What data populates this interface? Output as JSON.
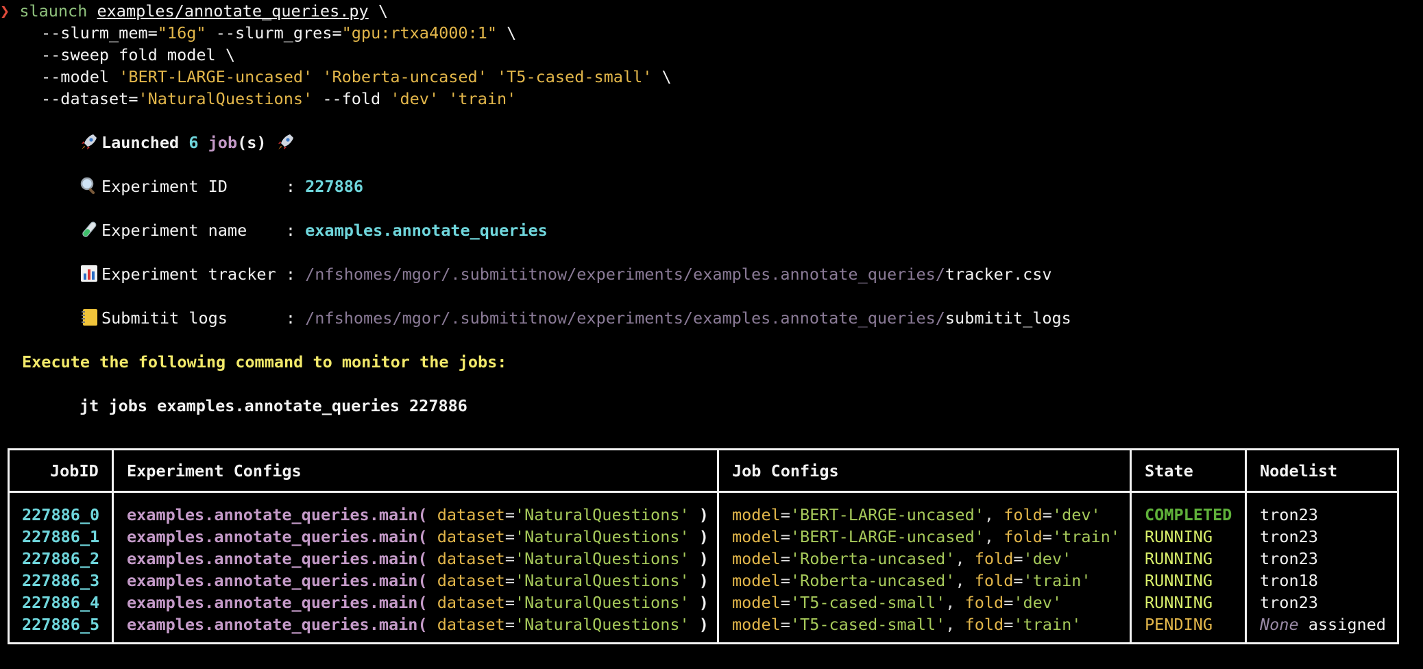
{
  "terminal": {
    "prompt_symbol": "❯",
    "command": {
      "program": "slaunch",
      "script": "examples/annotate_queries.py",
      "continuation": "\\",
      "line2": {
        "flag_mem": "--slurm_mem=",
        "mem_value": "\"16g\"",
        "flag_gres": "--slurm_gres=",
        "gres_value": "\"gpu:rtxa4000:1\""
      },
      "line3": "--sweep fold model \\",
      "line4": {
        "flag_model": "--model",
        "models": [
          "'BERT-LARGE-uncased'",
          "'Roberta-uncased'",
          "'T5-cased-small'"
        ]
      },
      "line5": {
        "flag_dataset": "--dataset=",
        "dataset_value": "'NaturalQuestions'",
        "flag_fold": "--fold",
        "folds": [
          "'dev'",
          "'train'"
        ]
      }
    },
    "launched": {
      "prefix": "Launched",
      "count": "6",
      "unit": "job",
      "suffix": "(s)"
    },
    "info": {
      "experiment_id_label": "Experiment ID      :",
      "experiment_id": "227886",
      "experiment_name_label": "Experiment name    :",
      "experiment_name": "examples.annotate_queries",
      "tracker_label": "Experiment tracker :",
      "tracker_dir": "/nfshomes/mgor/.submititnow/experiments/examples.annotate_queries/",
      "tracker_file": "tracker.csv",
      "logs_label": "Submitit logs      :",
      "logs_dir": "/nfshomes/mgor/.submititnow/experiments/examples.annotate_queries/",
      "logs_file": "submitit_logs"
    },
    "monitor_banner": "Execute the following command to monitor the jobs:",
    "monitor_command": "jt jobs examples.annotate_queries 227886"
  },
  "table": {
    "headers": [
      "JobID",
      "Experiment Configs",
      "Job Configs",
      "State",
      "Nodelist"
    ],
    "rows": [
      {
        "job_id": "227886_0",
        "fn": "examples.annotate_queries.main(",
        "kw": "dataset",
        "ds": "'NaturalQuestions'",
        "model": "'BERT-LARGE-uncased'",
        "fold": "'dev'",
        "state": "COMPLETED",
        "node": "tron23"
      },
      {
        "job_id": "227886_1",
        "fn": "examples.annotate_queries.main(",
        "kw": "dataset",
        "ds": "'NaturalQuestions'",
        "model": "'BERT-LARGE-uncased'",
        "fold": "'train'",
        "state": "RUNNING",
        "node": "tron23"
      },
      {
        "job_id": "227886_2",
        "fn": "examples.annotate_queries.main(",
        "kw": "dataset",
        "ds": "'NaturalQuestions'",
        "model": "'Roberta-uncased'",
        "fold": "'dev'",
        "state": "RUNNING",
        "node": "tron23"
      },
      {
        "job_id": "227886_3",
        "fn": "examples.annotate_queries.main(",
        "kw": "dataset",
        "ds": "'NaturalQuestions'",
        "model": "'Roberta-uncased'",
        "fold": "'train'",
        "state": "RUNNING",
        "node": "tron18"
      },
      {
        "job_id": "227886_4",
        "fn": "examples.annotate_queries.main(",
        "kw": "dataset",
        "ds": "'NaturalQuestions'",
        "model": "'T5-cased-small'",
        "fold": "'dev'",
        "state": "RUNNING",
        "node": "tron23"
      },
      {
        "job_id": "227886_5",
        "fn": "examples.annotate_queries.main(",
        "kw": "dataset",
        "ds": "'NaturalQuestions'",
        "model": "'T5-cased-small'",
        "fold": "'train'",
        "state": "PENDING",
        "node_none": "None",
        "node_suffix": "assigned"
      }
    ],
    "close_paren": ")",
    "model_key": "model",
    "fold_key": "fold",
    "separator": ","
  },
  "colors": {
    "background": "#000000",
    "prompt": "#e04a3a",
    "command": "#8ec07c",
    "string": "#e2b64a",
    "cyan": "#6fd6dc",
    "function": "#c49ac8",
    "banner": "#f2e96a",
    "completed": "#5fb13a",
    "running": "#d7ed6a",
    "pending": "#e2b64a"
  },
  "icons": [
    "rocket-icon",
    "magnifier-icon",
    "test-tube-icon",
    "bar-chart-icon",
    "notebook-icon"
  ]
}
